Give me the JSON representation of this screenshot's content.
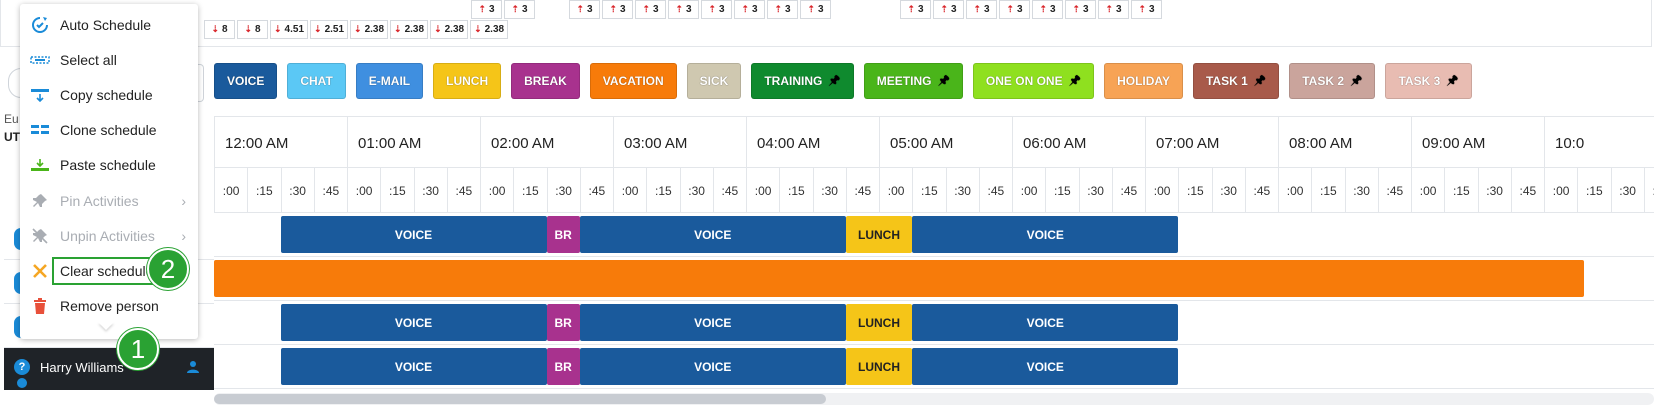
{
  "stats": {
    "group_a": [
      {
        "dir": "down",
        "value": "8"
      },
      {
        "dir": "down",
        "value": "8"
      },
      {
        "dir": "down",
        "value": "4.51"
      },
      {
        "dir": "down",
        "value": "2.51"
      },
      {
        "dir": "down",
        "value": "2.38"
      },
      {
        "dir": "down",
        "value": "2.38"
      },
      {
        "dir": "down",
        "value": "2.38"
      },
      {
        "dir": "down",
        "value": "2.38"
      }
    ],
    "group_b": [
      {
        "dir": "up",
        "value": "3"
      },
      {
        "dir": "up",
        "value": "3"
      }
    ],
    "group_c": [
      {
        "dir": "up",
        "value": "3"
      },
      {
        "dir": "up",
        "value": "3"
      },
      {
        "dir": "up",
        "value": "3"
      },
      {
        "dir": "up",
        "value": "3"
      },
      {
        "dir": "up",
        "value": "3"
      },
      {
        "dir": "up",
        "value": "3"
      },
      {
        "dir": "up",
        "value": "3"
      },
      {
        "dir": "up",
        "value": "3"
      }
    ],
    "group_d": [
      {
        "dir": "up",
        "value": "3"
      },
      {
        "dir": "up",
        "value": "3"
      },
      {
        "dir": "up",
        "value": "3"
      },
      {
        "dir": "up",
        "value": "3"
      },
      {
        "dir": "up",
        "value": "3"
      },
      {
        "dir": "up",
        "value": "3"
      },
      {
        "dir": "up",
        "value": "3"
      },
      {
        "dir": "up",
        "value": "3"
      }
    ]
  },
  "legend": [
    {
      "label": "VOICE",
      "color": "#1a5a9c",
      "pinned": false
    },
    {
      "label": "CHAT",
      "color": "#5bc8f5",
      "pinned": false
    },
    {
      "label": "E-MAIL",
      "color": "#3f8fe0",
      "pinned": false
    },
    {
      "label": "LUNCH",
      "color": "#f5c518",
      "pinned": false
    },
    {
      "label": "BREAK",
      "color": "#a8328e",
      "pinned": false
    },
    {
      "label": "VACATION",
      "color": "#f77b0a",
      "pinned": false
    },
    {
      "label": "SICK",
      "color": "#cfc8b0",
      "pinned": false
    },
    {
      "label": "TRAINING",
      "color": "#0f8a2e",
      "pinned": true
    },
    {
      "label": "MEETING",
      "color": "#4ab51a",
      "pinned": true
    },
    {
      "label": "ONE ON ONE",
      "color": "#8fe01f",
      "pinned": true
    },
    {
      "label": "HOLIDAY",
      "color": "#f7a355",
      "pinned": false
    },
    {
      "label": "TASK 1",
      "color": "#a85a4a",
      "pinned": true
    },
    {
      "label": "TASK 2",
      "color": "#caa49c",
      "pinned": true
    },
    {
      "label": "TASK 3",
      "color": "#e8bcb2",
      "pinned": true
    }
  ],
  "side_text": {
    "line1": "Eu",
    "line2": "UT"
  },
  "timeline": {
    "hours": [
      "12:00 AM",
      "01:00 AM",
      "02:00 AM",
      "03:00 AM",
      "04:00 AM",
      "05:00 AM",
      "06:00 AM",
      "07:00 AM",
      "08:00 AM",
      "09:00 AM",
      "10:0"
    ],
    "quarters": [
      ":00",
      ":15",
      ":30",
      ":45"
    ]
  },
  "schedule_rows": [
    {
      "blocks": [
        {
          "label": "VOICE",
          "activity": "VOICE",
          "start": 0.5,
          "end": 2.5
        },
        {
          "label": "BR",
          "activity": "BREAK",
          "start": 2.5,
          "end": 2.75
        },
        {
          "label": "VOICE",
          "activity": "VOICE",
          "start": 2.75,
          "end": 4.75
        },
        {
          "label": "LUNCH",
          "activity": "LUNCH",
          "start": 4.75,
          "end": 5.25
        },
        {
          "label": "VOICE",
          "activity": "VOICE",
          "start": 5.25,
          "end": 7.25
        }
      ]
    },
    {
      "blocks": [
        {
          "label": "",
          "activity": "VACATION",
          "start": 0,
          "end": 10.3
        }
      ]
    },
    {
      "blocks": [
        {
          "label": "VOICE",
          "activity": "VOICE",
          "start": 0.5,
          "end": 2.5
        },
        {
          "label": "BR",
          "activity": "BREAK",
          "start": 2.5,
          "end": 2.75
        },
        {
          "label": "VOICE",
          "activity": "VOICE",
          "start": 2.75,
          "end": 4.75
        },
        {
          "label": "LUNCH",
          "activity": "LUNCH",
          "start": 4.75,
          "end": 5.25
        },
        {
          "label": "VOICE",
          "activity": "VOICE",
          "start": 5.25,
          "end": 7.25
        }
      ]
    },
    {
      "blocks": [
        {
          "label": "VOICE",
          "activity": "VOICE",
          "start": 0.5,
          "end": 2.5
        },
        {
          "label": "BR",
          "activity": "BREAK",
          "start": 2.5,
          "end": 2.75
        },
        {
          "label": "VOICE",
          "activity": "VOICE",
          "start": 2.75,
          "end": 4.75
        },
        {
          "label": "LUNCH",
          "activity": "LUNCH",
          "start": 4.75,
          "end": 5.25
        },
        {
          "label": "VOICE",
          "activity": "VOICE",
          "start": 5.25,
          "end": 7.25
        }
      ]
    }
  ],
  "activity_colors": {
    "VOICE": "#1a5a9c",
    "BREAK": "#a8328e",
    "LUNCH": "#f5c518",
    "VACATION": "#f77b0a",
    "text_dark": "#222222"
  },
  "person": {
    "name": "Harry Williams",
    "status_icon": "?"
  },
  "badges": {
    "step1": "1",
    "step2": "2"
  },
  "context_menu": {
    "items": [
      {
        "label": "Auto Schedule",
        "icon": "auto-schedule-icon",
        "disabled": false,
        "submenu": false
      },
      {
        "label": "Select all",
        "icon": "select-all-icon",
        "disabled": false,
        "submenu": false
      },
      {
        "label": "Copy schedule",
        "icon": "copy-schedule-icon",
        "disabled": false,
        "submenu": false
      },
      {
        "label": "Clone schedule",
        "icon": "clone-schedule-icon",
        "disabled": false,
        "submenu": false
      },
      {
        "label": "Paste schedule",
        "icon": "paste-schedule-icon",
        "disabled": false,
        "submenu": false
      },
      {
        "label": "Pin Activities",
        "icon": "pin-icon",
        "disabled": true,
        "submenu": true
      },
      {
        "label": "Unpin Activities",
        "icon": "unpin-icon",
        "disabled": true,
        "submenu": true
      },
      {
        "label": "Clear schedule",
        "icon": "clear-icon",
        "disabled": false,
        "submenu": false,
        "highlighted": true
      },
      {
        "label": "Remove person",
        "icon": "trash-icon",
        "disabled": false,
        "submenu": false
      }
    ]
  }
}
